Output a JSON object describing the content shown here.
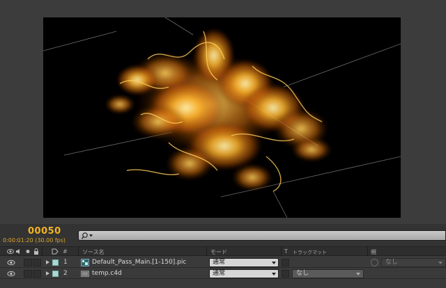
{
  "timeline": {
    "current_frame": "00050",
    "timecode": "0:00:01:20 (30.00 fps)",
    "search_icon": "magnifier-dropdown-icon"
  },
  "columns": {
    "source_name": "ソース名",
    "mode": "モード",
    "t": "T",
    "track_matte": "トラックマット",
    "parent": "親"
  },
  "layers": [
    {
      "number": "1",
      "name": "Default_Pass_Main.[1-150].pic",
      "mode": "通常",
      "track_matte": "",
      "parent": "なし",
      "icon": "footage-sequence-icon",
      "label_color": "#a8d8d4"
    },
    {
      "number": "2",
      "name": "temp.c4d",
      "mode": "通常",
      "track_matte": "なし",
      "parent": "",
      "icon": "c4d-file-icon",
      "label_color": "#a8d8d4"
    }
  ]
}
